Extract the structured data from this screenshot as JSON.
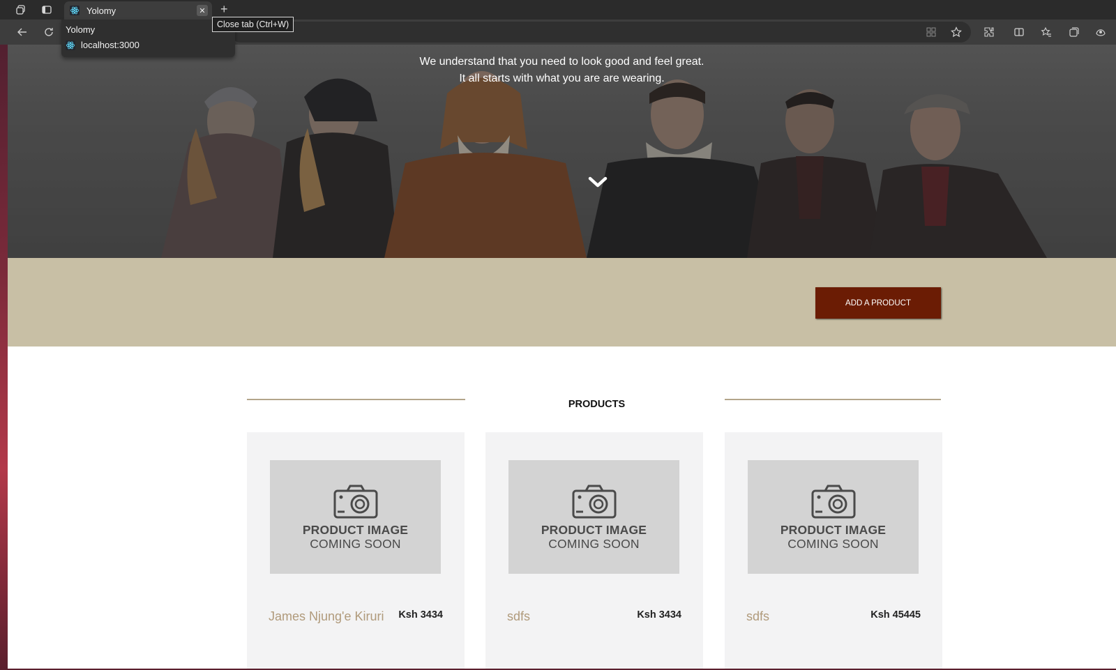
{
  "browser": {
    "tab_title": "Yolomy",
    "tooltip": "Close tab (Ctrl+W)",
    "hovercard": {
      "title": "Yolomy",
      "url": "localhost:3000"
    },
    "icons": [
      "workspaces-icon",
      "tab-actions-icon",
      "react-favicon-icon",
      "close-icon",
      "new-tab-icon",
      "back-icon",
      "refresh-icon",
      "app-available-icon",
      "favorite-star-icon",
      "extensions-icon",
      "split-screen-icon",
      "favorites-icon",
      "collections-icon",
      "copilot-icon"
    ]
  },
  "hero": {
    "line1": "We understand that you need to look good and feel great.",
    "line2": "It all starts with what you are are wearing."
  },
  "actions": {
    "add_product": "ADD A PRODUCT"
  },
  "products": {
    "heading": "PRODUCTS",
    "placeholder_line1": "PRODUCT IMAGE",
    "placeholder_line2": "COMING SOON",
    "items": [
      {
        "name": "James Njung'e Kiruri",
        "price": "Ksh 3434"
      },
      {
        "name": "sdfs",
        "price": "Ksh 3434"
      },
      {
        "name": "sdfs",
        "price": "Ksh 45445"
      }
    ]
  },
  "colors": {
    "band": "#c8bfa5",
    "button": "#6b1c04",
    "name_text": "#b09a7b",
    "card_bg": "#f3f3f4",
    "placeholder_bg": "#d3d3d3"
  }
}
